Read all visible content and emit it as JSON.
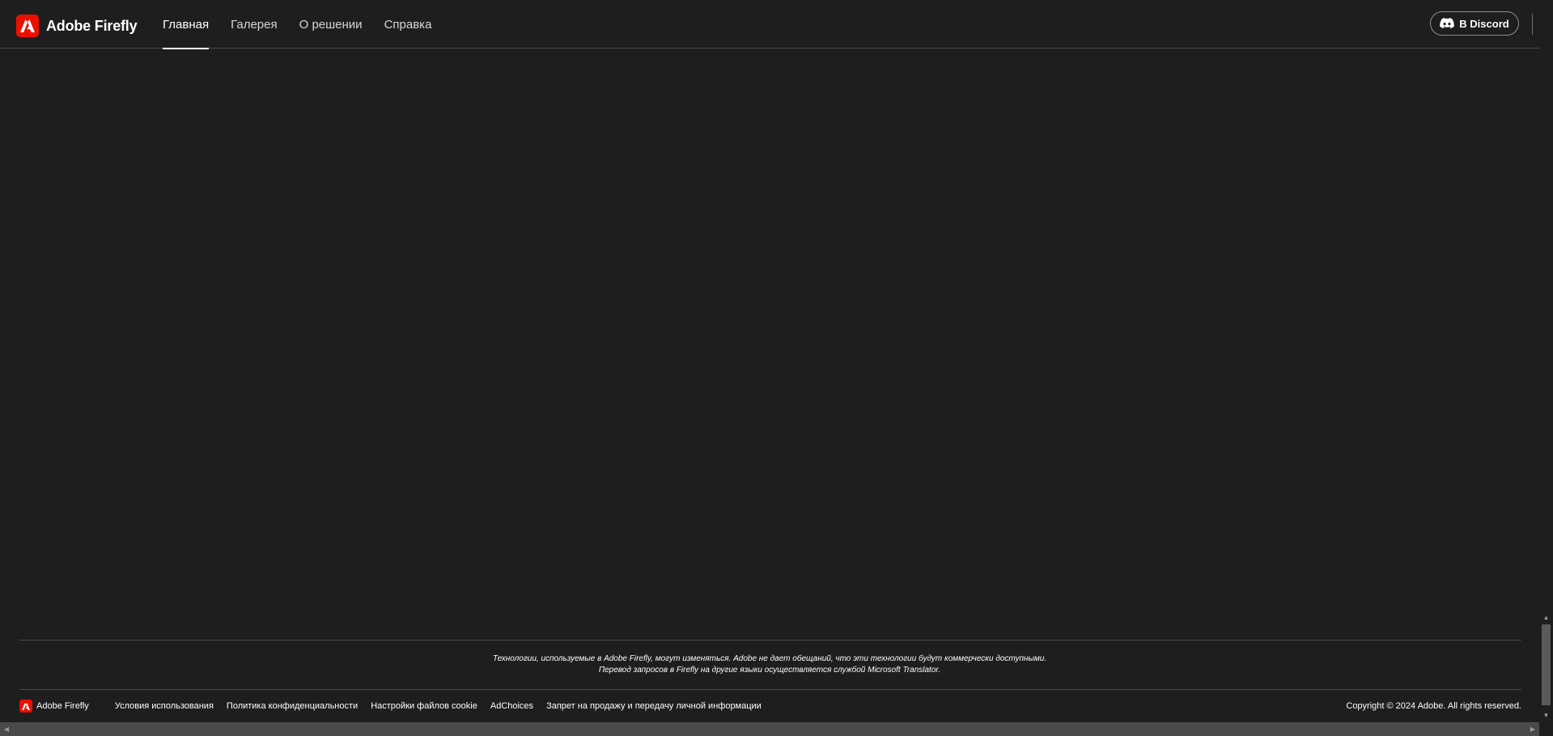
{
  "header": {
    "brand_name": "Adobe Firefly",
    "tabs": [
      {
        "label": "Главная",
        "active": true
      },
      {
        "label": "Галерея",
        "active": false
      },
      {
        "label": "О решении",
        "active": false
      },
      {
        "label": "Справка",
        "active": false
      }
    ],
    "discord_label": "В Discord"
  },
  "footer": {
    "disclaimer_line1": "Технологии, используемые в Adobe Firefly, могут изменяться. Adobe не дает обещаний, что эти технологии будут коммерчески доступными.",
    "disclaimer_line2": "Перевод запросов в Firefly на другие языки осуществляется службой Microsoft Translator.",
    "brand_name": "Adobe Firefly",
    "links": [
      "Условия использования",
      "Политика конфиденциальности",
      "Настройки файлов cookie",
      "AdChoices",
      "Запрет на продажу и передачу личной информации"
    ],
    "copyright": "Copyright © 2024 Adobe. All rights reserved."
  },
  "colors": {
    "background": "#1e1e1e",
    "brand_red": "#eb1000",
    "divider": "#4a4a4a"
  },
  "icons": {
    "brand": "adobe-logo-icon",
    "discord": "discord-icon"
  }
}
